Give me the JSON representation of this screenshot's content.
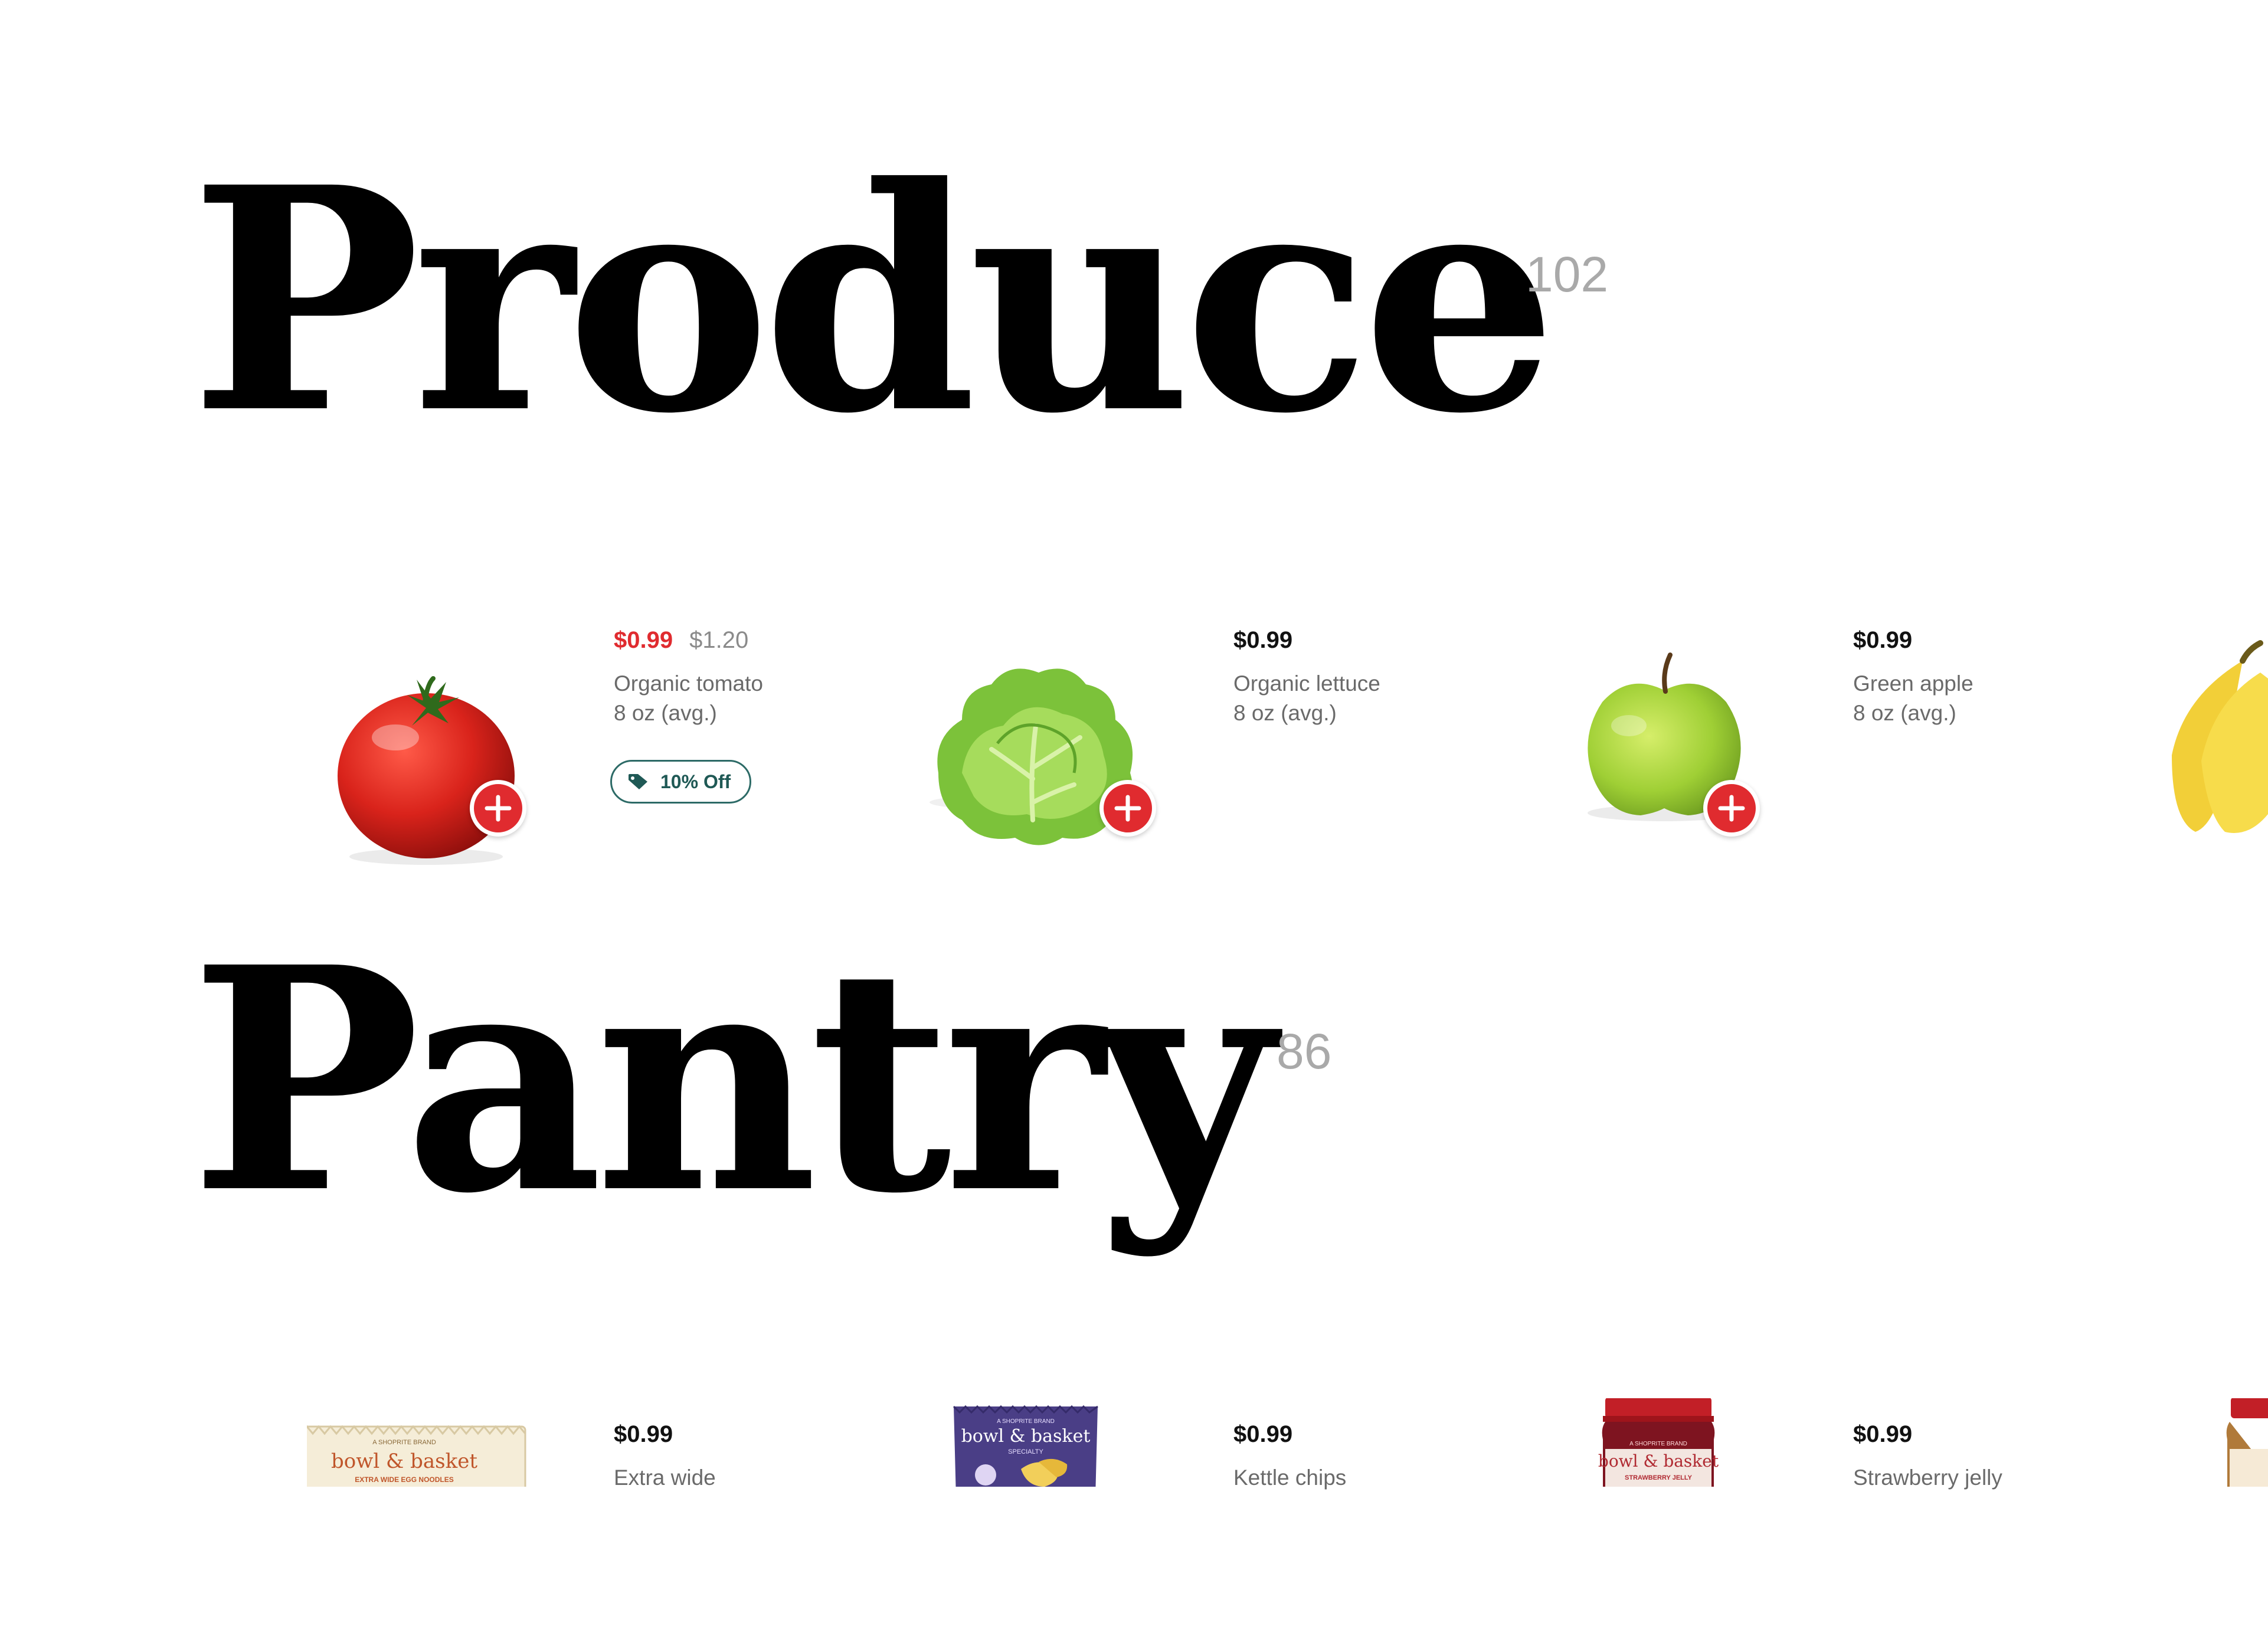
{
  "sections": [
    {
      "title": "Produce",
      "count": "102",
      "items": [
        {
          "price": "$0.99",
          "old_price": "$1.20",
          "name": "Organic tomato",
          "size": "8 oz (avg.)",
          "badge": "10% Off",
          "icon": "tomato-image"
        },
        {
          "price": "$0.99",
          "name": "Organic lettuce",
          "size": "8 oz (avg.)",
          "icon": "lettuce-image"
        },
        {
          "price": "$0.99",
          "name": "Green apple",
          "size": "8 oz (avg.)",
          "icon": "green-apple-image"
        },
        {
          "icon": "banana-image"
        }
      ]
    },
    {
      "title": "Pantry",
      "count": "86",
      "items": [
        {
          "price": "$0.99",
          "name": "Extra wide",
          "icon": "noodles-package-image",
          "brand": "bowl & basket",
          "brand_sub": "EXTRA WIDE EGG NOODLES",
          "brand_top": "A SHOPRITE BRAND"
        },
        {
          "price": "$0.99",
          "name": "Kettle chips",
          "icon": "kettle-chips-bag-image",
          "brand": "bowl & basket",
          "brand_sub": "SPECIALTY",
          "brand_top": "A SHOPRITE BRAND"
        },
        {
          "price": "$0.99",
          "name": "Strawberry jelly",
          "icon": "strawberry-jelly-jar-image",
          "brand": "bowl & basket",
          "brand_sub": "STRAWBERRY JELLY",
          "brand_top": "A SHOPRITE BRAND"
        },
        {
          "icon": "peanut-butter-jar-image"
        }
      ]
    }
  ],
  "colors": {
    "accent": "#e02b2f",
    "badge": "#2c6a66",
    "count": "#a9a9a9"
  }
}
